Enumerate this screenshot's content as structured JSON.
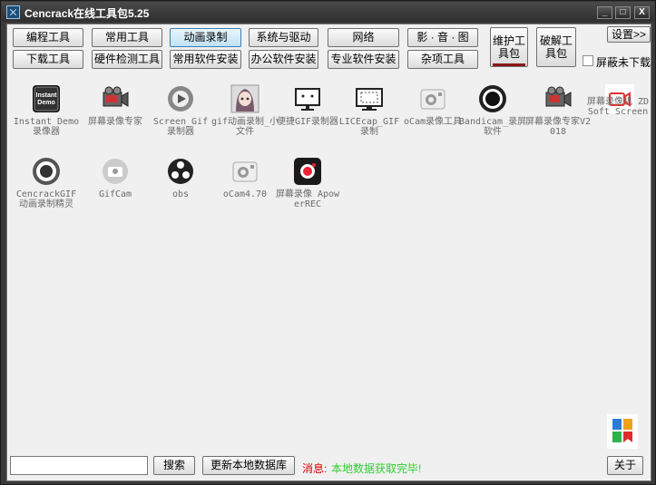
{
  "window": {
    "title": "Cencrack在线工具包5.25"
  },
  "titlebar_buttons": {
    "minimize": "_",
    "maximize": "□",
    "close": "X"
  },
  "categories": {
    "row1": [
      "编程工具",
      "常用工具",
      "动画录制",
      "系统与驱动",
      "网络",
      "影 · 音 · 图"
    ],
    "row2": [
      "下载工具",
      "硬件检测工具",
      "常用软件安装",
      "办公软件安装",
      "专业软件安装",
      "杂项工具"
    ],
    "active": "动画录制",
    "maintenance_pack": "维护工具包",
    "crack_pack": "破解工具包",
    "settings": "设置>>",
    "hide_not_downloaded": "屏蔽未下载"
  },
  "tools": [
    {
      "label": "Instant Demo 录像器",
      "icon": "instant-demo-icon"
    },
    {
      "label": "屏幕录像专家",
      "icon": "film-camera-icon"
    },
    {
      "label": "Screen_Gif 录制器",
      "icon": "play-circle-icon"
    },
    {
      "label": "gif动画录制_小文件",
      "icon": "anime-girl-icon"
    },
    {
      "label": "便捷GIF录制器",
      "icon": "monitor-icon"
    },
    {
      "label": "LICEcap_GIF录制",
      "icon": "screen-capture-icon"
    },
    {
      "label": "oCam录像工具",
      "icon": "ocam-icon"
    },
    {
      "label": "Bandicam_录屏软件",
      "icon": "bandicam-record-icon"
    },
    {
      "label": "屏幕录像专家V2018",
      "icon": "film-camera-icon"
    },
    {
      "label": "屏幕录像机 ZD Soft Screen",
      "icon": "video-camera-icon"
    },
    {
      "label": "CencrackGIF 动画录制精灵",
      "icon": "record-dot-icon"
    },
    {
      "label": "GifCam",
      "icon": "gifcam-icon"
    },
    {
      "label": "obs",
      "icon": "obs-icon"
    },
    {
      "label": "oCam4.70",
      "icon": "ocam-icon"
    },
    {
      "label": "屏幕录像 ApowerREC",
      "icon": "apowerrec-icon"
    }
  ],
  "bottom": {
    "search_placeholder": "",
    "search_button": "搜索",
    "update_button": "更新本地数据库",
    "status_prefix": "消息:",
    "status_message": "本地数据获取完毕!",
    "about_button": "关于"
  },
  "colors": {
    "status_prefix": "#e00000",
    "status_message": "#33cc33",
    "active_tab": "#bfe2f6"
  }
}
